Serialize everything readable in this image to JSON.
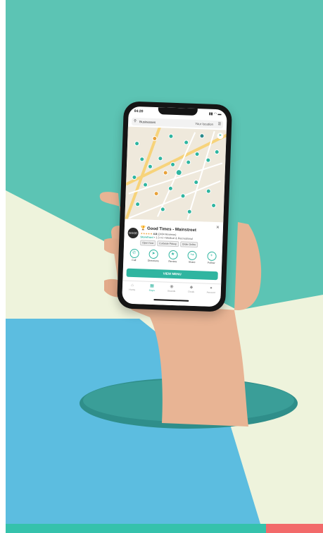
{
  "colors": {
    "teal_bg": "#5cc4b4",
    "cream_bg": "#eef3dc",
    "blue_bg": "#5cbde0",
    "hole": "#2f8e8a",
    "brand": "#2fb5a0",
    "accent_orange": "#e8a23b",
    "bottom_teal": "#35c2ac",
    "bottom_red": "#f26a6a"
  },
  "status_bar": {
    "time": "04:20",
    "signal": "▮▮ ◠ ▬"
  },
  "search": {
    "icon": "search-icon",
    "query": "Businesses",
    "location": "Your location",
    "filter_icon": "filter-icon"
  },
  "map": {
    "locate_icon": "navigation-arrow-icon"
  },
  "listing": {
    "logo_text": "GOOD TIMES",
    "name": "Good Times - Mainstreet",
    "rating_stars": "★★★★★",
    "rating_value": "4.8",
    "rating_count": "(2484 Reviews)",
    "open_status": "Storefront",
    "distance_info": "• 1.3 mi • Medical & Recreational",
    "tags": [
      "Open Now",
      "Curbside Pickup",
      "Order Online"
    ],
    "close_icon": "close-icon"
  },
  "actions": [
    {
      "label": "Call",
      "icon": "phone-icon",
      "glyph": "✆"
    },
    {
      "label": "Directions",
      "icon": "directions-icon",
      "glyph": "➤"
    },
    {
      "label": "Review",
      "icon": "star-icon",
      "glyph": "★"
    },
    {
      "label": "Share",
      "icon": "share-icon",
      "glyph": "↪"
    },
    {
      "label": "Follow",
      "icon": "plus-icon",
      "glyph": "+"
    }
  ],
  "cta": {
    "label": "VIEW MENU"
  },
  "tabs": [
    {
      "label": "Home",
      "glyph": "⌂",
      "active": false
    },
    {
      "label": "Maps",
      "glyph": "▦",
      "active": true
    },
    {
      "label": "Brands",
      "glyph": "◉",
      "active": false
    },
    {
      "label": "Deals",
      "glyph": "◆",
      "active": false
    },
    {
      "label": "Account",
      "glyph": "●",
      "active": false
    }
  ]
}
